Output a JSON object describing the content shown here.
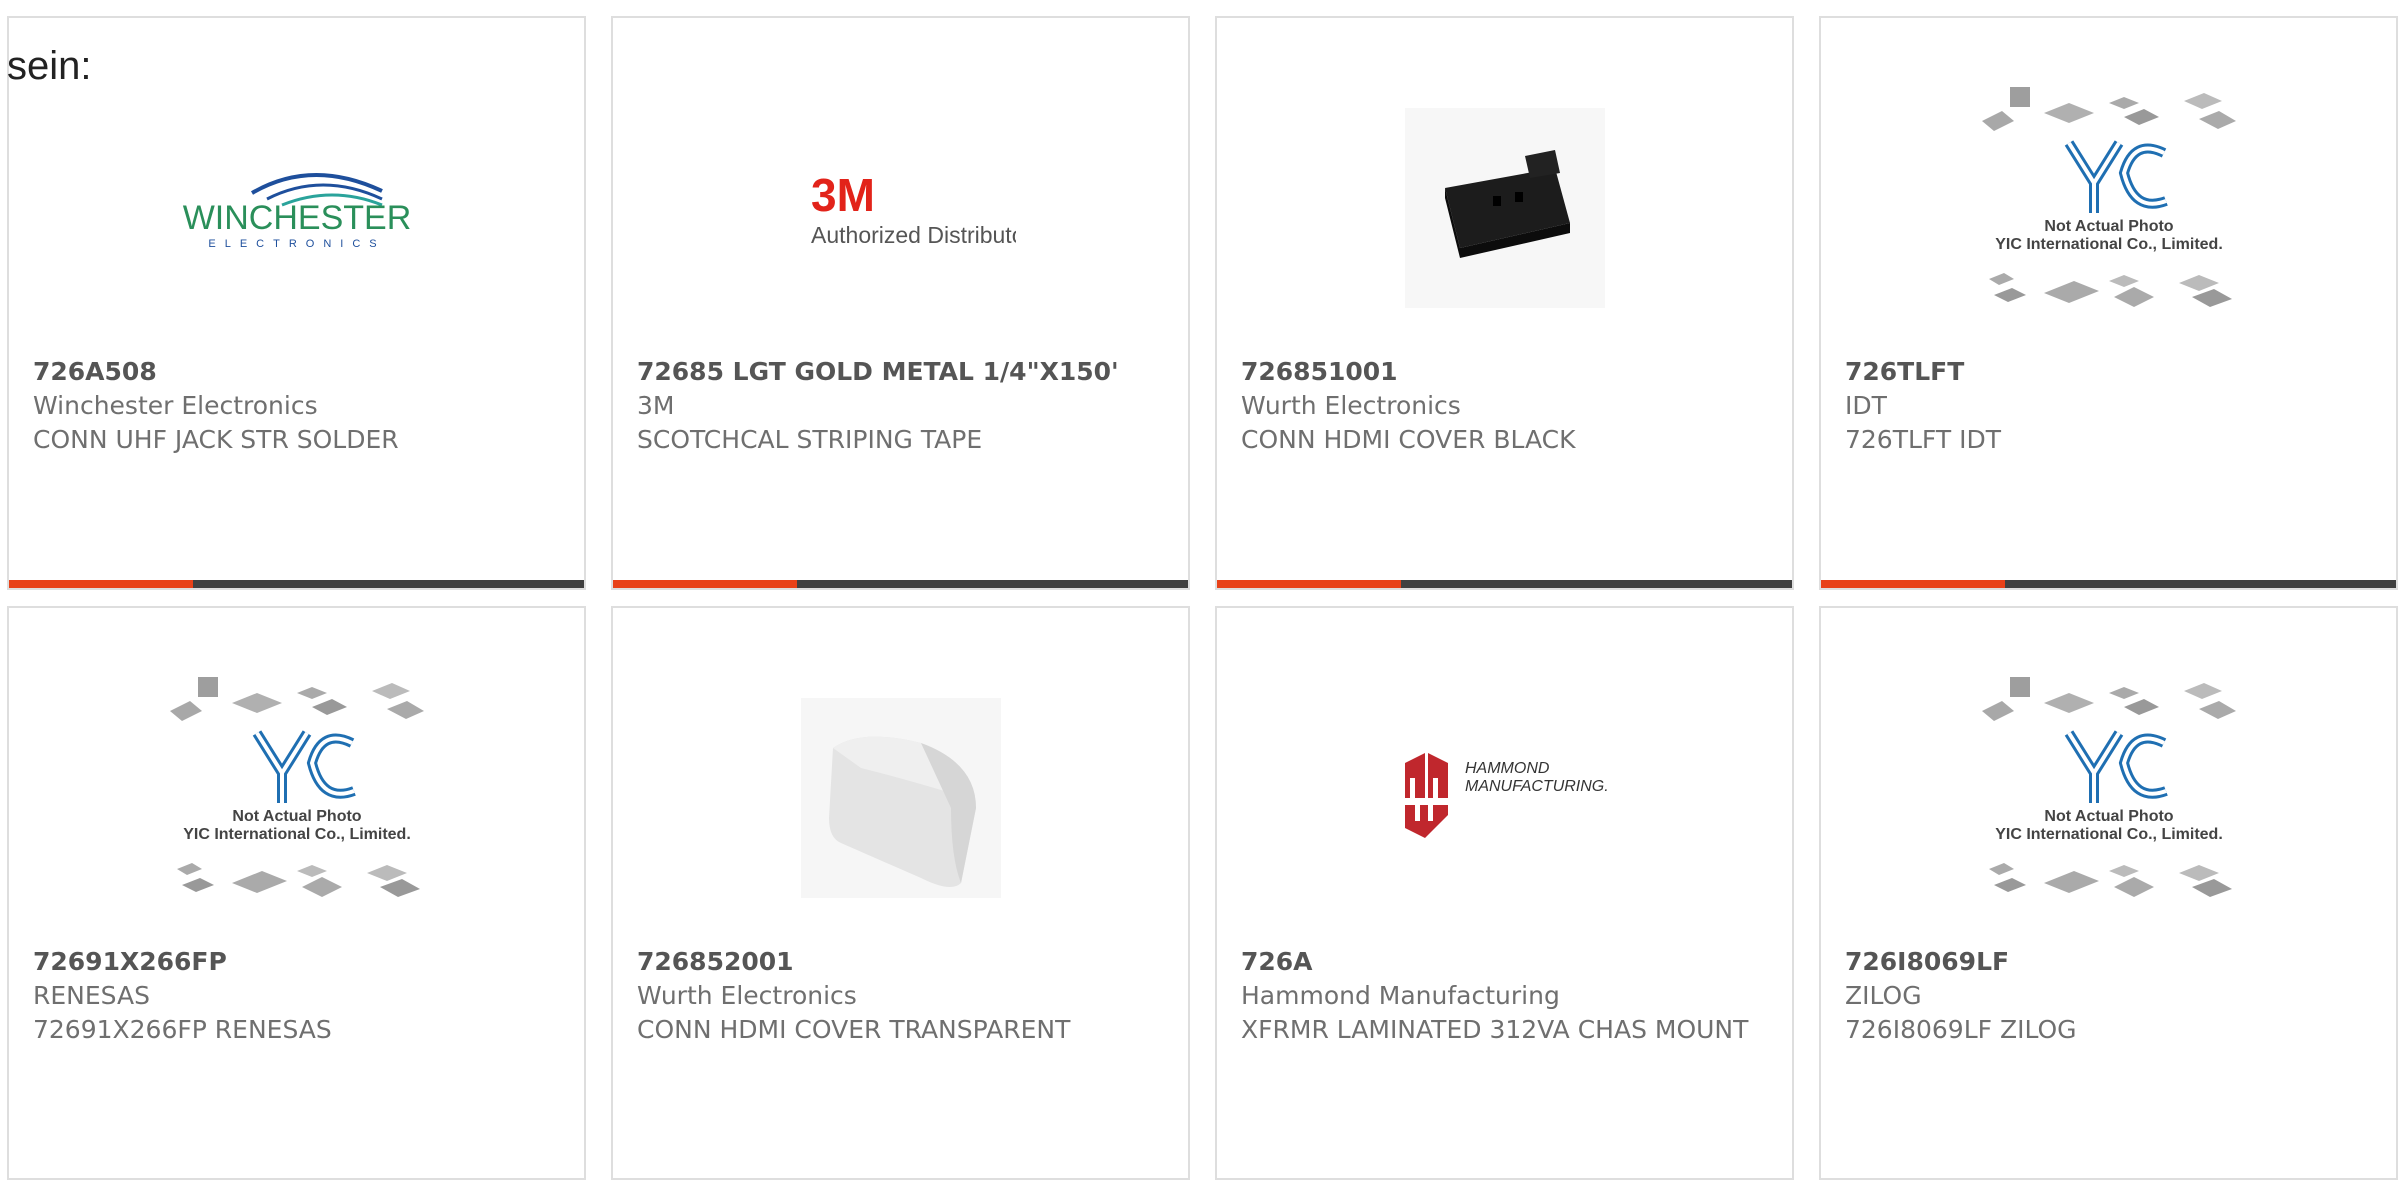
{
  "prefix_text": "sein:",
  "colors": {
    "accent": "#e84118",
    "bar": "#404040",
    "border": "#dedede",
    "text": "#6f6f6f"
  },
  "logos": {
    "winchester": {
      "word": "WINCHESTER",
      "sub": "ELECTRONICS"
    },
    "three_m": {
      "brand": "3M",
      "tagline": "Authorized Distributor"
    },
    "yic": {
      "mark": "YIC",
      "line1": "Not Actual Photo",
      "line2": "YIC International Co., Limited."
    },
    "hammond": {
      "line1": "HAMMOND",
      "line2": "MANUFACTURING."
    }
  },
  "products": [
    {
      "part_number": "726A508",
      "manufacturer": "Winchester Electronics",
      "description": "CONN UHF JACK STR SOLDER",
      "image": "winchester-logo"
    },
    {
      "part_number": "72685 LGT GOLD METAL 1/4\"X150'",
      "manufacturer": "3M",
      "description": "SCOTCHCAL STRIPING TAPE",
      "image": "3m-logo"
    },
    {
      "part_number": "726851001",
      "manufacturer": "Wurth Electronics",
      "description": "CONN HDMI COVER BLACK",
      "image": "hdmi-cover-black-photo"
    },
    {
      "part_number": "726TLFT",
      "manufacturer": "IDT",
      "description": "726TLFT IDT",
      "image": "yic-placeholder"
    },
    {
      "part_number": "72691X266FP",
      "manufacturer": "RENESAS",
      "description": "72691X266FP RENESAS",
      "image": "yic-placeholder"
    },
    {
      "part_number": "726852001",
      "manufacturer": "Wurth Electronics",
      "description": "CONN HDMI COVER TRANSPARENT",
      "image": "hdmi-cover-transparent-photo"
    },
    {
      "part_number": "726A",
      "manufacturer": "Hammond Manufacturing",
      "description": "XFRMR LAMINATED 312VA CHAS MOUNT",
      "image": "hammond-logo"
    },
    {
      "part_number": "726I8069LF",
      "manufacturer": "ZILOG",
      "description": "726I8069LF ZILOG",
      "image": "yic-placeholder"
    }
  ]
}
